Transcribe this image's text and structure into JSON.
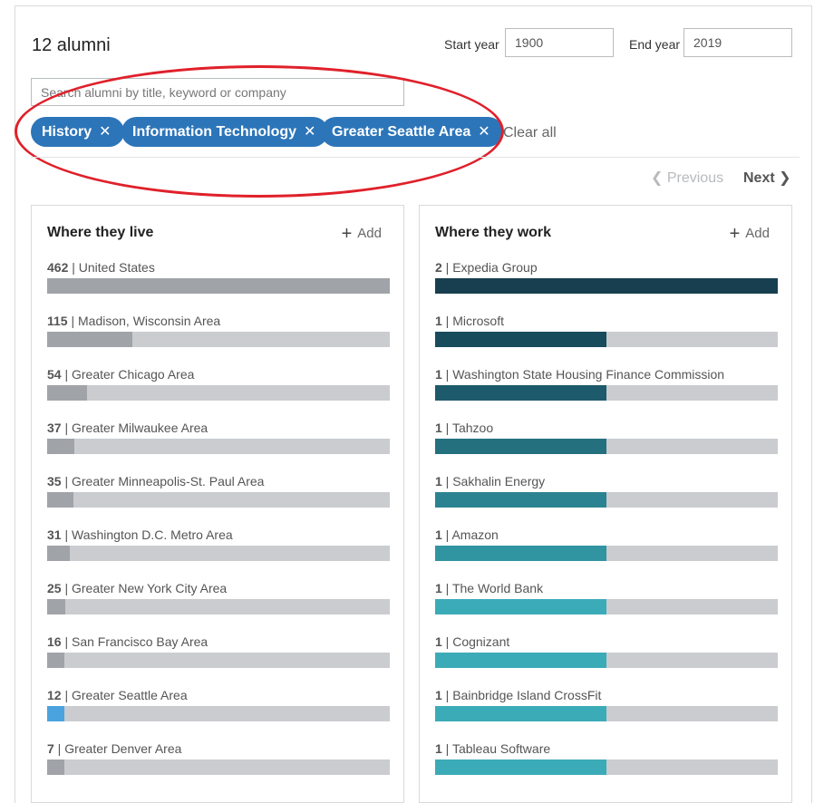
{
  "header": {
    "title": "12 alumni",
    "start_year_label": "Start year",
    "start_year_value": "1900",
    "end_year_label": "End year",
    "end_year_value": "2019"
  },
  "search": {
    "placeholder": "Search alumni by title, keyword or company"
  },
  "filters": [
    {
      "label": "History",
      "remove": "✕"
    },
    {
      "label": "Information Technology",
      "remove": "✕"
    },
    {
      "label": "Greater Seattle Area",
      "remove": "✕"
    }
  ],
  "clear_all": "Clear all",
  "pager": {
    "previous": "❮ Previous",
    "next": "Next ❯"
  },
  "where_they_live": {
    "title": "Where they live",
    "add": "Add",
    "items": [
      {
        "count": "462",
        "label": "| United States",
        "fraction": 1.0,
        "color": "#a0a3a7"
      },
      {
        "count": "115",
        "label": "| Madison, Wisconsin Area",
        "fraction": 0.249,
        "color": "#a0a3a7"
      },
      {
        "count": "54",
        "label": "| Greater Chicago Area",
        "fraction": 0.117,
        "color": "#a0a3a7"
      },
      {
        "count": "37",
        "label": "| Greater Milwaukee Area",
        "fraction": 0.08,
        "color": "#a0a3a7"
      },
      {
        "count": "35",
        "label": "| Greater Minneapolis-St. Paul Area",
        "fraction": 0.076,
        "color": "#a0a3a7"
      },
      {
        "count": "31",
        "label": "| Washington D.C. Metro Area",
        "fraction": 0.067,
        "color": "#a0a3a7"
      },
      {
        "count": "25",
        "label": "| Greater New York City Area",
        "fraction": 0.054,
        "color": "#a0a3a7"
      },
      {
        "count": "16",
        "label": "| San Francisco Bay Area",
        "fraction": 0.05,
        "color": "#a0a3a7"
      },
      {
        "count": "12",
        "label": "| Greater Seattle Area",
        "fraction": 0.05,
        "color": "#4aa3df"
      },
      {
        "count": "7",
        "label": "| Greater Denver Area",
        "fraction": 0.05,
        "color": "#a0a3a7"
      }
    ]
  },
  "where_they_work": {
    "title": "Where they work",
    "add": "Add",
    "items": [
      {
        "count": "2",
        "label": "| Expedia Group",
        "fraction": 1.0,
        "color": "#173f4f"
      },
      {
        "count": "1",
        "label": "| Microsoft",
        "fraction": 0.5,
        "color": "#184c5c"
      },
      {
        "count": "1",
        "label": "| Washington State Housing Finance Commission",
        "fraction": 0.5,
        "color": "#1d5a6b"
      },
      {
        "count": "1",
        "label": "| Tahzoo",
        "fraction": 0.5,
        "color": "#25707f"
      },
      {
        "count": "1",
        "label": "| Sakhalin Energy",
        "fraction": 0.5,
        "color": "#2b8391"
      },
      {
        "count": "1",
        "label": "| Amazon",
        "fraction": 0.5,
        "color": "#3194a1"
      },
      {
        "count": "1",
        "label": "| The World Bank",
        "fraction": 0.5,
        "color": "#3cabb8"
      },
      {
        "count": "1",
        "label": "| Cognizant",
        "fraction": 0.5,
        "color": "#3cabb8"
      },
      {
        "count": "1",
        "label": "| Bainbridge Island CrossFit",
        "fraction": 0.5,
        "color": "#3cabb8"
      },
      {
        "count": "1",
        "label": "| Tableau Software",
        "fraction": 0.5,
        "color": "#3cabb8"
      }
    ]
  }
}
